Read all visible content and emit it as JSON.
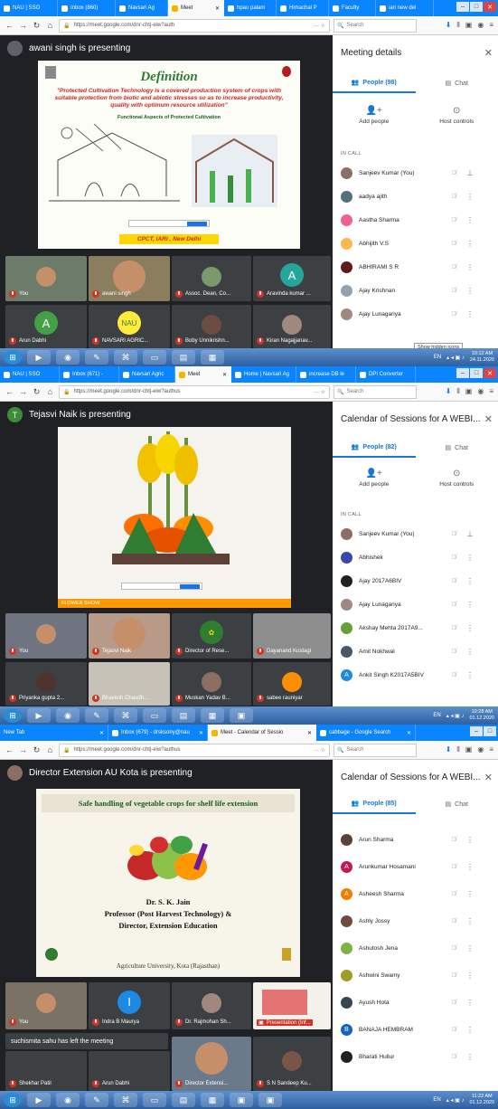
{
  "screens": [
    {
      "tabs": [
        {
          "label": "NAU | SSO",
          "active": false
        },
        {
          "label": "Inbox (860)",
          "active": false
        },
        {
          "label": "Navsari Ag",
          "active": false
        },
        {
          "label": "Meet",
          "active": true
        },
        {
          "label": "hpau palam",
          "active": false
        },
        {
          "label": "Himachal P",
          "active": false
        },
        {
          "label": "Faculty",
          "active": false
        },
        {
          "label": "iari new del",
          "active": false
        }
      ],
      "url": "https://meet.google.com/dnr-chtj-eiw?auth",
      "search_placeholder": "Search",
      "presenter_initial": "",
      "presenter": "awani singh is presenting",
      "slide": {
        "heading": "Definition",
        "body": "\"Protected Cultivation Technology is a covered production system of crops with suitable protection from biotic and abiotic stresses so as to increase productivity, quality with optimum resource utilization\"",
        "caption": "Functional Aspects of Protected Cultivation",
        "footer": "CPCT, IARI , New Delhi"
      },
      "tiles": [
        "You",
        "awani singh",
        "Assoc. Dean, Co...",
        "Aravinda kumar ...",
        "Arun Dabhi",
        "NAVSARI AGRIC...",
        "Boby Unnikrishn...",
        "Kiran Nagajjanav..."
      ],
      "tile_letters": {
        "aravinda": "A",
        "arun": "A"
      },
      "panel": {
        "title": "Meeting details",
        "people_tab": "People (98)",
        "chat_tab": "Chat",
        "add_people": "Add people",
        "host_controls": "Host controls",
        "in_call": "IN CALL",
        "people": [
          "Sanjeev Kumar (You)",
          "aadya ajith",
          "Aastha Sharma",
          "Abhijith V.S",
          "ABHIRAMI S R",
          "Ajay Krishnan",
          "Ajay Lunagariya"
        ]
      },
      "tooltip": "Show hidden icons",
      "clock": {
        "lang": "EN",
        "time": "10:12 AM",
        "date": "24.11.2020"
      }
    },
    {
      "tabs": [
        {
          "label": "NAU | SSO",
          "active": false
        },
        {
          "label": "Inbox (671) -",
          "active": false
        },
        {
          "label": "Navsari Agric",
          "active": false
        },
        {
          "label": "Meet",
          "active": true
        },
        {
          "label": "Home | Navsari Ag",
          "active": false
        },
        {
          "label": "increase DB le",
          "active": false
        },
        {
          "label": "DPI Converter",
          "active": false
        }
      ],
      "url": "https://meet.google.com/dnr-chtj-eiw?authus",
      "search_placeholder": "Search",
      "presenter_initial": "T",
      "presenter": "Tejasvi Naik is presenting",
      "slide_caption": "FLOWER SHOW",
      "tiles": [
        "You",
        "Tejasvi Naik",
        "Director of Rese...",
        "Dayanand Kustagi",
        "Priyanka gupta 2...",
        "Bhavesh Chaudh...",
        "Muskan Yadav B...",
        "sabee rauniyar"
      ],
      "panel": {
        "title": "Calendar of Sessions for A WEBI...",
        "people_tab": "People (82)",
        "chat_tab": "Chat",
        "add_people": "Add people",
        "host_controls": "Host controls",
        "in_call": "IN CALL",
        "people": [
          "Sanjeev Kumar (You)",
          "Abhishek",
          "Ajay 2017A6BIV",
          "Ajay Lunagariya",
          "Akshay Mehta 2017A9...",
          "Amit Nokhwal",
          "Ankit Singh K2017A5BIV"
        ]
      },
      "people_letters": {
        "ankit": "A"
      },
      "clock": {
        "lang": "EN",
        "time": "10:28 AM",
        "date": "01.12.2020"
      }
    },
    {
      "tabs": [
        {
          "label": "New Tab",
          "active": false
        },
        {
          "label": "Inbox (679) - drsksony@nau",
          "active": false
        },
        {
          "label": "Meet - Calendar of Sessio",
          "active": true
        },
        {
          "label": "cabbage - Google Search",
          "active": false
        }
      ],
      "url": "https://meet.google.com/dnr-chtj-eiw?authus",
      "search_placeholder": "Search",
      "presenter_initial": "",
      "presenter": "Director Extension AU Kota is presenting",
      "slide": {
        "title": "Safe handling of vegetable crops for shelf life extension",
        "name": "Dr. S. K. Jain",
        "role1": "Professor (Post Harvest Technology) &",
        "role2": "Director, Extension Education",
        "footer": "Agriculture University, Kota (Rajasthan)"
      },
      "tiles": [
        "You",
        "Indra B Maurya",
        "Dr. Rajmohan Sh...",
        "Presentation (Inf...",
        "Shekhar Patil",
        "Arun Dabhi",
        "Director Extensi...",
        "S N Sandeep Ku..."
      ],
      "tile_letters": {
        "indra": "I"
      },
      "notice": "suchismita sahu has left the meeting",
      "panel": {
        "title": "Calendar of Sessions for A WEBI...",
        "people_tab": "People (85)",
        "chat_tab": "Chat",
        "people": [
          "Arun Sharma",
          "Arunkumar Hosamani",
          "Asheesh Sharma",
          "Ashly Jossy",
          "Ashutosh Jena",
          "Ashwini Swamy",
          "Ayush Hota",
          "BANAJA HEMBRAM",
          "Bharati Hullur"
        ]
      },
      "people_letters": {
        "arunkumar": "A",
        "asheesh": "A",
        "banaja": "B"
      },
      "clock": {
        "lang": "EN",
        "time": "11:22 AM",
        "date": "01.12.2020"
      }
    }
  ],
  "colors": {
    "meet_bg": "#202124",
    "firefox_tab": "#0a84ff",
    "mute_red": "#d93025",
    "meet_blue": "#1a73e8"
  }
}
